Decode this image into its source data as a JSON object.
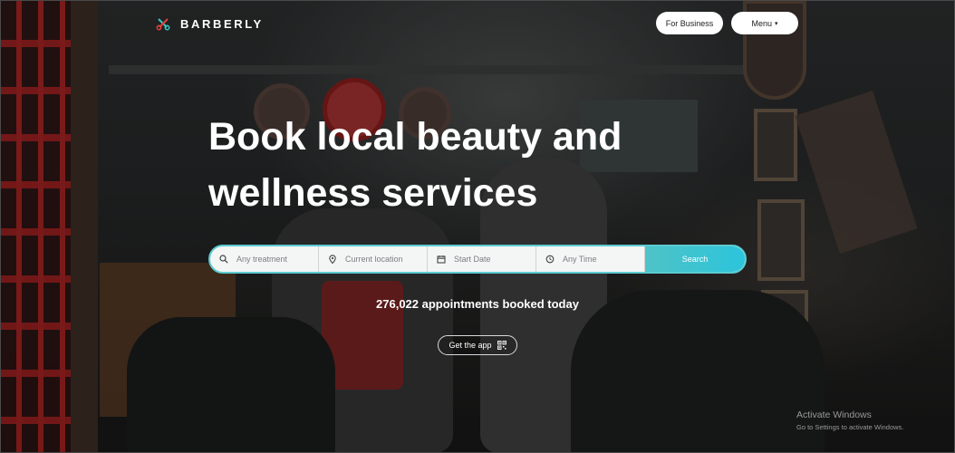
{
  "header": {
    "brand": "BARBERLY",
    "for_business_label": "For Business",
    "menu_label": "Menu"
  },
  "hero": {
    "title_line1": "Book local beauty and",
    "title_line2": "wellness services"
  },
  "search": {
    "treatment_placeholder": "Any treatment",
    "location_placeholder": "Current location",
    "date_placeholder": "Start Date",
    "time_placeholder": "Any Time",
    "button_label": "Search"
  },
  "stats": {
    "bookings_text": "276,022 appointments booked today"
  },
  "app": {
    "button_label": "Get the app"
  },
  "watermark": {
    "title": "Activate Windows",
    "subtitle": "Go to Settings to activate Windows."
  },
  "colors": {
    "accent": "#2cc4dc",
    "accent_border": "#5ccbd1",
    "logo_red": "#e2403a",
    "logo_teal": "#3cc3c0"
  },
  "icons": {
    "logo": "scissors-icon",
    "treatment": "search-icon",
    "location": "location-pin-icon",
    "date": "calendar-icon",
    "time": "clock-icon",
    "menu": "caret-down-icon",
    "app": "qr-code-icon"
  }
}
